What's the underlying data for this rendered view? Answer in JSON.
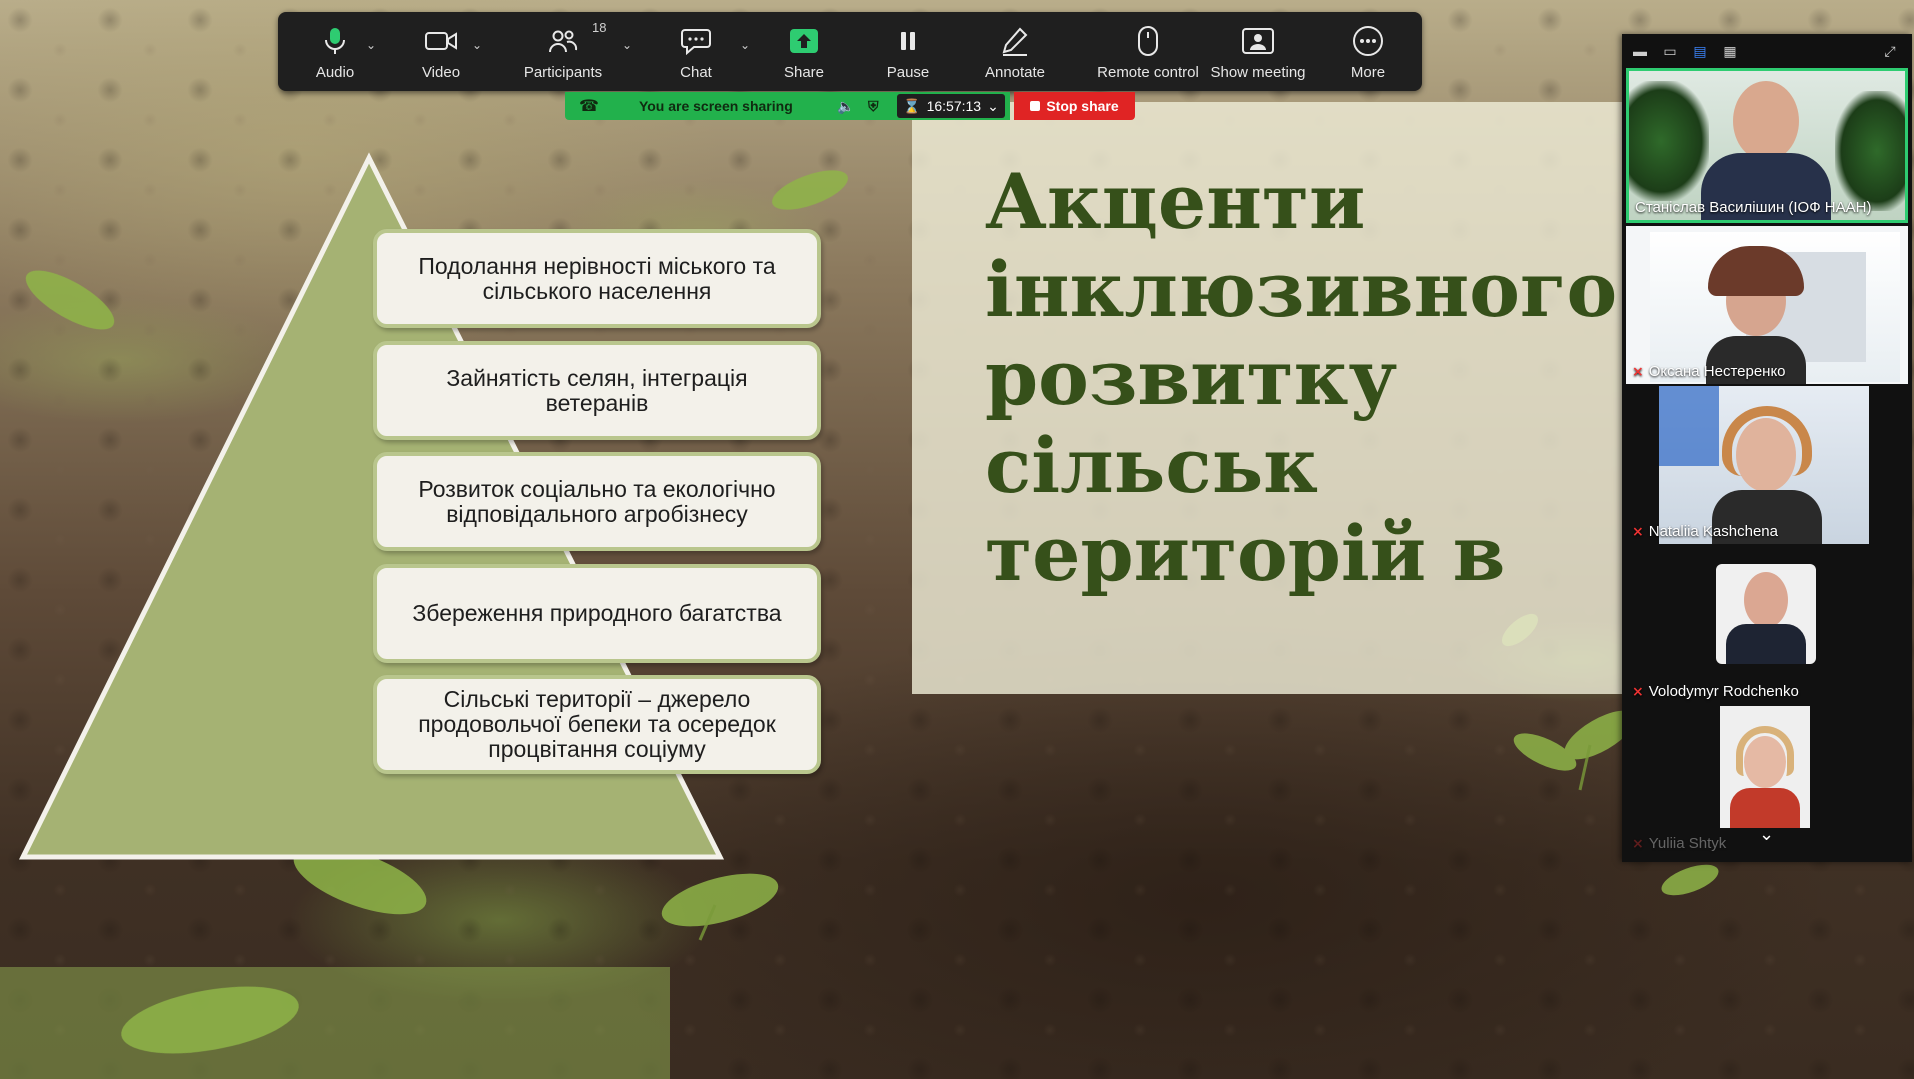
{
  "slide": {
    "title": "Акценти\nінклюзивного\nрозвитку сільськ\nтериторій в\nпіслявоєнній Укр",
    "pyramid_items": [
      "Подолання нерівності міського та сільського населення",
      "Зайнятість селян, інтеграція ветеранів",
      "Розвиток соціально та екологічно відповідального агробізнесу",
      "Збереження природного багатства",
      "Сільські території – джерело продовольчої бепеки та осередок процвітання соціуму"
    ],
    "colors": {
      "title": "#36501a",
      "triangle": "#a5b273",
      "box_border": "#b9c68d"
    }
  },
  "toolbar": {
    "audio": "Audio",
    "video": "Video",
    "participants": "Participants",
    "participants_count": "18",
    "chat": "Chat",
    "share": "Share",
    "pause": "Pause",
    "annotate": "Annotate",
    "remote_control": "Remote control",
    "show_meeting": "Show meeting",
    "more": "More"
  },
  "share_status": {
    "message": "You are screen sharing",
    "timer": "16:57:13",
    "stop_label": "Stop share",
    "accent_color": "#22b14c",
    "stop_color": "#e02424"
  },
  "participants": [
    {
      "name": "Станіслав Василішин (ІОФ НААН)",
      "muted": false,
      "active_speaker": true
    },
    {
      "name": "Оксана Нестеренко",
      "muted": true,
      "active_speaker": false
    },
    {
      "name": "Nataliia Kashchena",
      "muted": true,
      "active_speaker": false
    },
    {
      "name": "Volodymyr Rodchenko",
      "muted": true,
      "active_speaker": false
    },
    {
      "name": "Yuliia Shtyk",
      "muted": true,
      "active_speaker": false
    }
  ]
}
